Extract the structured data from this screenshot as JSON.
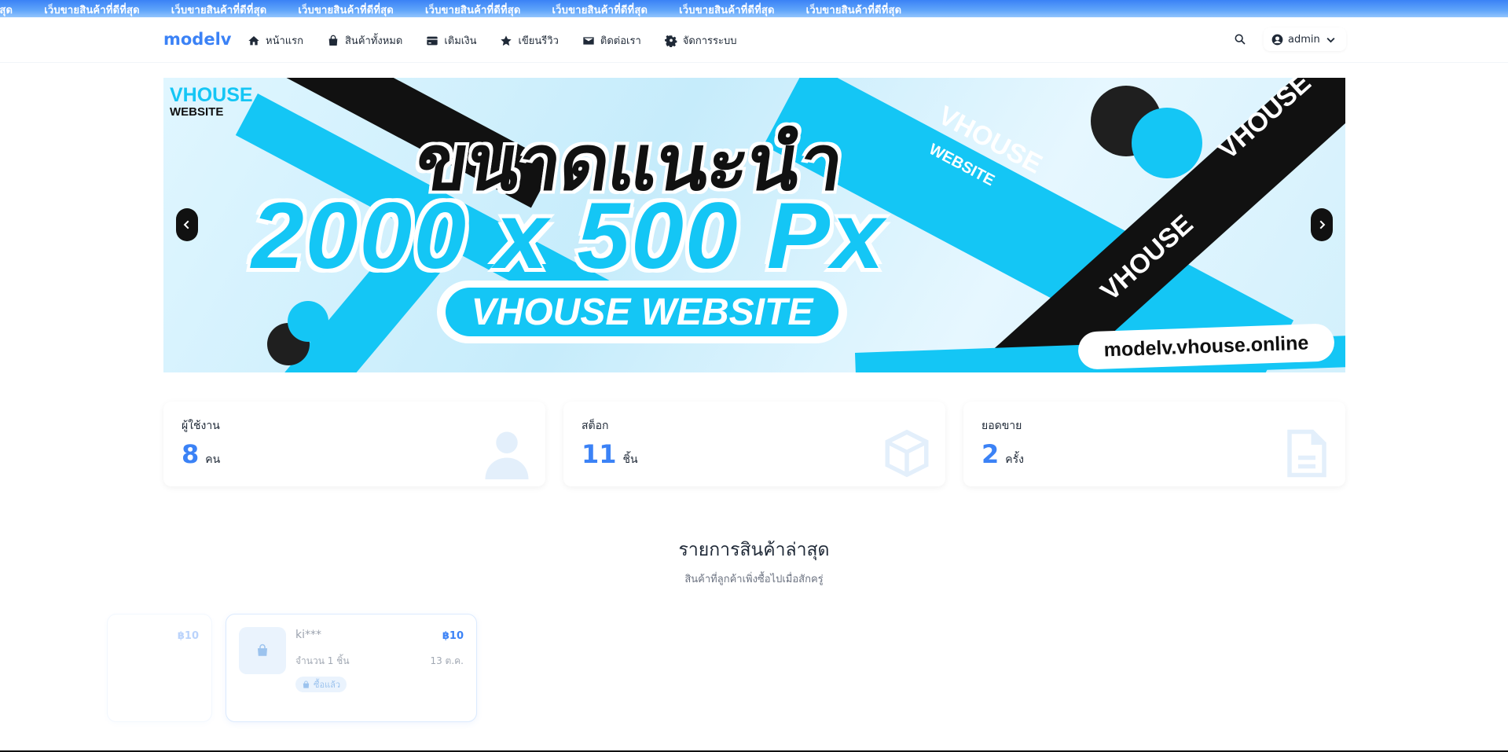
{
  "marquee": {
    "items": [
      "ดีที่สุด",
      "เว็บขายสินค้าที่ดีที่สุด",
      "เว็บขายสินค้าที่ดีที่สุด",
      "เว็บขายสินค้าที่ดีที่สุด",
      "เว็บขายสินค้าที่ดีที่สุด",
      "เว็บขายสินค้าที่ดีที่สุด",
      "เว็บขายสินค้าที่ดีที่สุด",
      "เว็บขายสินค้าที่ดีที่สุด"
    ]
  },
  "navbar": {
    "brand": "modelv",
    "items": [
      {
        "label": "หน้าแรก",
        "icon": "home-icon"
      },
      {
        "label": "สินค้าทั้งหมด",
        "icon": "bag-icon"
      },
      {
        "label": "เติมเงิน",
        "icon": "credit-card-icon"
      },
      {
        "label": "เขียนรีวิว",
        "icon": "star-icon"
      },
      {
        "label": "ติดต่อเรา",
        "icon": "envelope-icon"
      },
      {
        "label": "จัดการระบบ",
        "icon": "gear-icon"
      }
    ],
    "user": "admin"
  },
  "banner": {
    "logo_line1": "VHOUSE",
    "logo_line2": "WEBSITE",
    "headline": "ขนาดแนะนำ",
    "size": "2000 x 500 Px",
    "pill": "VHOUSE WEBSITE",
    "url": "modelv.vhouse.online",
    "stripe_text": "VHOUSE",
    "stripe_text2": "WEBSITE",
    "colors": {
      "cyan": "#14c6f5",
      "black": "#111111"
    }
  },
  "stats": [
    {
      "label": "ผู้ใช้งาน",
      "value": "8",
      "unit": "คน",
      "icon": "user-icon"
    },
    {
      "label": "สต็อก",
      "value": "11",
      "unit": "ชิ้น",
      "icon": "box-icon"
    },
    {
      "label": "ยอดขาย",
      "value": "2",
      "unit": "ครั้ง",
      "icon": "receipt-icon"
    }
  ],
  "section": {
    "title": "รายการสินค้าล่าสุด",
    "subtitle": "สินค้าที่ลูกค้าเพิ่งซื้อไปเมื่อสักครู่"
  },
  "recent": [
    {
      "name": "",
      "price": "฿10",
      "qty": "",
      "date": "",
      "badge": ""
    },
    {
      "name": "ki***",
      "price": "฿10",
      "qty": "จำนวน 1 ชิ้น",
      "date": "13 ต.ค.",
      "badge": "ซื้อแล้ว"
    }
  ],
  "accent": "#3b82f6"
}
